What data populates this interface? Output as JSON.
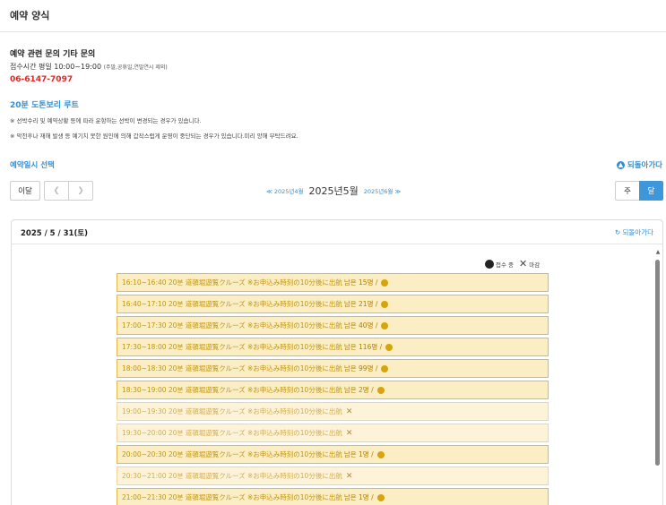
{
  "header": {
    "title": "예약 양식"
  },
  "inquiry": {
    "heading": "예약 관련 문의 기타 문의",
    "hours_main": "접수시간 평일 10:00~19:00",
    "hours_note": "(주말,공휴일,연말연시 제외)",
    "phone": "06-6147-7097"
  },
  "route": {
    "title": "20분 도톤보리 루트",
    "notes": [
      "※ 선박수리 및 예약상황 등에 따라 운항하는 선박이 변경되는 경우가 있습니다.",
      "※ 악천후나 재해 발생 등 예기치 못한 원인에 의해 갑작스럽게 운영이 중단되는 경우가 있습니다.미리 양해 부탁드려요."
    ]
  },
  "select_label": "예약일시 선택",
  "back_top": "되돌아가다",
  "nav": {
    "this_month": "이달",
    "prev_icon": "chevron-left",
    "next_icon": "chevron-right",
    "prev_month": "≪ 2025년4월",
    "current_month": "2025년5월",
    "next_month": "2025년6월 ≫",
    "week": "주",
    "month": "달"
  },
  "panel": {
    "date": "2025 / 5 / 31(토)",
    "back": "되돌아가다",
    "legend_open": "접수 중",
    "legend_closed": "마감"
  },
  "slots": [
    {
      "text": "16:10~16:40 20분 道頓堀遊覧クルーズ ※お申込み時刻の10分後に出航",
      "remain": "남은 15명 /",
      "open": true
    },
    {
      "text": "16:40~17:10 20분 道頓堀遊覧クルーズ ※お申込み時刻の10分後に出航",
      "remain": "남은 21명 /",
      "open": true
    },
    {
      "text": "17:00~17:30 20분 道頓堀遊覧クルーズ ※お申込み時刻の10分後に出航",
      "remain": "남은 40명 /",
      "open": true
    },
    {
      "text": "17:30~18:00 20분 道頓堀遊覧クルーズ ※お申込み時刻の10分後に出航",
      "remain": "남은 116명 /",
      "open": true
    },
    {
      "text": "18:00~18:30 20분 道頓堀遊覧クルーズ ※お申込み時刻の10分後に出航",
      "remain": "남은 99명 /",
      "open": true
    },
    {
      "text": "18:30~19:00 20분 道頓堀遊覧クルーズ ※お申込み時刻の10分後に出航",
      "remain": "남은 2명 /",
      "open": true
    },
    {
      "text": "19:00~19:30 20분 道頓堀遊覧クルーズ ※お申込み時刻の10分後に出航",
      "remain": "",
      "open": false
    },
    {
      "text": "19:30~20:00 20분 道頓堀遊覧クルーズ ※お申込み時刻の10分後に出航",
      "remain": "",
      "open": false
    },
    {
      "text": "20:00~20:30 20분 道頓堀遊覧クルーズ ※お申込み時刻の10分後に出航",
      "remain": "남은 1명 /",
      "open": true
    },
    {
      "text": "20:30~21:00 20분 道頓堀遊覧クルーズ ※お申込み時刻の10分後に出航",
      "remain": "",
      "open": false
    },
    {
      "text": "21:00~21:30 20분 道頓堀遊覧クルーズ ※お申込み時刻の10分後に出航",
      "remain": "남은 1명 /",
      "open": true
    }
  ]
}
